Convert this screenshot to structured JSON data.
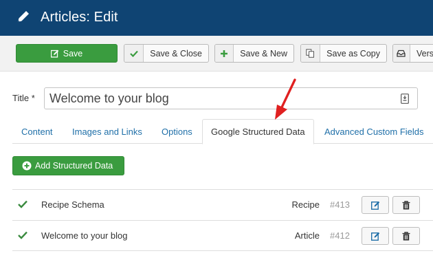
{
  "header": {
    "title": "Articles: Edit",
    "icon": "pencil-icon"
  },
  "toolbar": {
    "save": "Save",
    "save_close": "Save & Close",
    "save_new": "Save & New",
    "save_copy": "Save as Copy",
    "versions": "Vers"
  },
  "title_field": {
    "label": "Title *",
    "value": "Welcome to your blog"
  },
  "tabs": [
    {
      "label": "Content"
    },
    {
      "label": "Images and Links"
    },
    {
      "label": "Options"
    },
    {
      "label": "Google Structured Data",
      "active": true
    },
    {
      "label": "Advanced Custom Fields"
    }
  ],
  "add_button": "Add Structured Data",
  "rows": [
    {
      "name": "Recipe Schema",
      "type": "Recipe",
      "id": "#413"
    },
    {
      "name": "Welcome to your blog",
      "type": "Article",
      "id": "#412"
    }
  ],
  "colors": {
    "header": "#0f4473",
    "green": "#3a9c3f",
    "link": "#1f6fa8",
    "arrow": "#e02020"
  }
}
